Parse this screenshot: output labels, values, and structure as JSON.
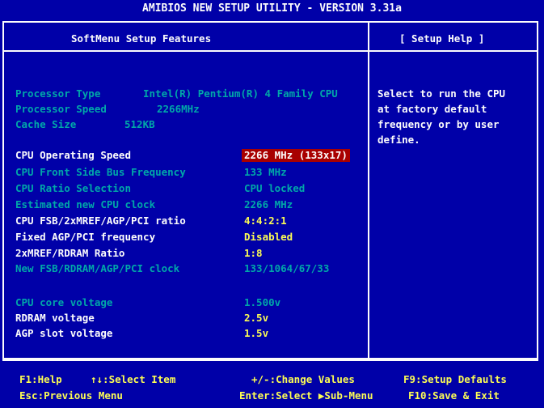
{
  "app_title": "AMIBIOS NEW SETUP UTILITY - VERSION 3.31a",
  "panel_title": "SoftMenu Setup Features",
  "help_title": "[ Setup Help ]",
  "info": [
    {
      "label": "Processor Type",
      "value": "Intel(R) Pentium(R) 4 Family CPU"
    },
    {
      "label": "Processor Speed",
      "value": "2266MHz"
    },
    {
      "label": "Cache Size",
      "value": "512KB"
    }
  ],
  "settings": [
    {
      "label": "CPU Operating Speed",
      "value": "2266 MHz (133x17)",
      "state": "selected"
    },
    {
      "label": "CPU Front Side Bus Frequency",
      "value": "133 MHz",
      "state": "disabled"
    },
    {
      "label": "CPU Ratio Selection",
      "value": "CPU locked",
      "state": "disabled"
    },
    {
      "label": "Estimated new CPU clock",
      "value": "2266 MHz",
      "state": "disabled"
    },
    {
      "label": "CPU FSB/2xMREF/AGP/PCI ratio",
      "value": "4:4:2:1",
      "state": "enabled"
    },
    {
      "label": "Fixed AGP/PCI frequency",
      "value": "Disabled",
      "state": "enabled"
    },
    {
      "label": "2xMREF/RDRAM Ratio",
      "value": "1:8",
      "state": "enabled"
    },
    {
      "label": "New FSB/RDRAM/AGP/PCI clock",
      "value": "133/1064/67/33",
      "state": "disabled"
    },
    {
      "label": "CPU core voltage",
      "value": "1.500v",
      "state": "disabled"
    },
    {
      "label": "RDRAM voltage",
      "value": "2.5v",
      "state": "enabled"
    },
    {
      "label": "AGP slot voltage",
      "value": "1.5v",
      "state": "enabled"
    }
  ],
  "help_text": "Select to run the CPU\nat factory default\nfrequency or by user\ndefine.",
  "footer": {
    "f1": "F1:Help",
    "select": "↑↓:Select Item",
    "change": "+/-:Change Values",
    "f9": "F9:Setup Defaults",
    "esc": "Esc:Previous Menu",
    "enter": "Enter:Select ▶Sub-Menu",
    "f10": "F10:Save & Exit"
  }
}
